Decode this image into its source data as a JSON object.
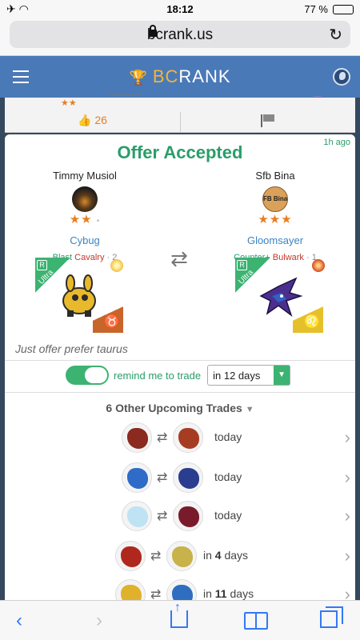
{
  "status": {
    "time": "18:12",
    "battery": "77 %",
    "battery_level": 0.77
  },
  "browser": {
    "url": "bcrank.us"
  },
  "app": {
    "brand_b": "BC",
    "brand_rest": "RANK"
  },
  "prev_card": {
    "likes": "26",
    "stars": "★★"
  },
  "offer": {
    "title": "Offer Accepted",
    "time_ago": "1h ago",
    "left": {
      "player": "Timmy Musiol",
      "stars": "★★",
      "monster": "Cybug",
      "tag1": "Blast",
      "tag2": "Cavalry",
      "tag_count": "· 2",
      "rarity": "Ultra",
      "rarity_badge": "R",
      "zodiac": "♉",
      "element": "light",
      "colors": {
        "body": "#e9b92c",
        "dark": "#2b2b2b"
      }
    },
    "right": {
      "player": "Sfb Bina",
      "avatar_text": "FB Bina",
      "stars": "★★★",
      "monster": "Gloomsayer",
      "tag1": "Counter+",
      "tag2": "Bulwark",
      "tag_count": "· 1",
      "rarity": "Ultra",
      "rarity_badge": "R",
      "zodiac": "♌",
      "element": "fire",
      "colors": {
        "body": "#4b2f8f",
        "accent": "#2f62c4"
      }
    },
    "swap_icon": "⇄",
    "note": "Just offer prefer taurus",
    "remind_label": "remind me to trade",
    "remind_enabled": true,
    "remind_select": "in 12 days"
  },
  "upcoming": {
    "header": "6 Other Upcoming Trades",
    "trades": [
      {
        "when": "today",
        "a": "#8b2a1f",
        "b": "#a63d22"
      },
      {
        "when": "today",
        "a": "#2e6cc8",
        "b": "#2a3d8f"
      },
      {
        "when": "today",
        "a": "#bfe3f2",
        "b": "#7a1b2b"
      },
      {
        "when_prefix": "in ",
        "when_num": "4",
        "when_suffix": " days",
        "a": "#b0281d",
        "b": "#c8b24a"
      },
      {
        "when_prefix": "in ",
        "when_num": "11",
        "when_suffix": " days",
        "a": "#e0b12b",
        "b": "#2f6dc0"
      }
    ]
  }
}
